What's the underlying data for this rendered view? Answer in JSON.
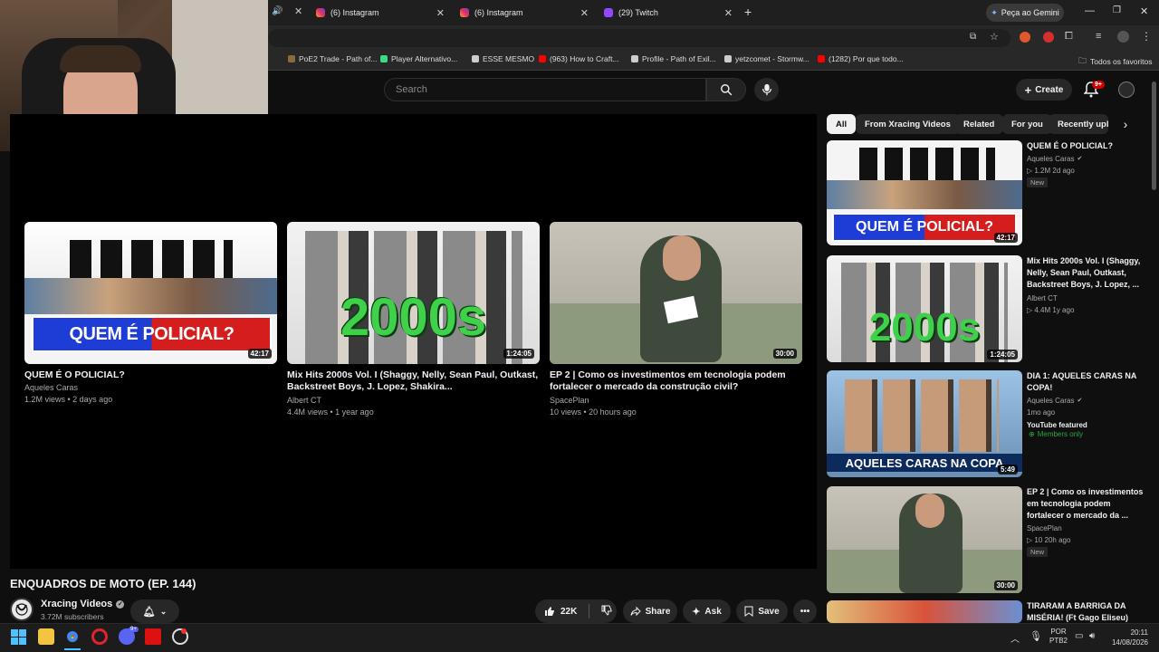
{
  "browser": {
    "tabs": [
      {
        "label": "(6) Instagram"
      },
      {
        "label": "(6) Instagram"
      },
      {
        "label": "(29) Twitch"
      }
    ],
    "gemini_label": "Peça ao Gemini",
    "bookmarks": [
      {
        "label": "PoE2 Trade - Path of..."
      },
      {
        "label": "Player Alternativo..."
      },
      {
        "label": "ESSE MESMO"
      },
      {
        "label": "(963) How to Craft..."
      },
      {
        "label": "Profile - Path of Exil..."
      },
      {
        "label": "yetzcomet - Stormw..."
      },
      {
        "label": "(1282) Por que todo..."
      }
    ],
    "bookmarks_folder": "Todos os favoritos"
  },
  "youtube": {
    "search_placeholder": "Search",
    "create_label": "Create",
    "notif_count": "9+"
  },
  "endscreen": [
    {
      "title": "QUEM É O POLICIAL?",
      "channel": "Aqueles Caras",
      "meta": "1.2M views • 2 days ago",
      "duration": "42:17",
      "thumb_text": "QUEM É POLICIAL?"
    },
    {
      "title": "Mix Hits 2000s Vol. I (Shaggy, Nelly, Sean Paul, Outkast, Backstreet Boys, J. Lopez, Shakira...",
      "channel": "Albert CT",
      "meta": "4.4M views • 1 year ago",
      "duration": "1:24:05",
      "thumb_text": "2000s"
    },
    {
      "title": "EP 2 | Como os investimentos em tecnologia podem fortalecer o mercado da construção civil?",
      "channel": "SpacePlan",
      "meta": "10 views • 20 hours ago",
      "duration": "30:00",
      "thumb_text": ""
    }
  ],
  "video": {
    "title": "ENQUADROS DE MOTO (EP. 144)",
    "channel": "Xracing Videos",
    "subscribers": "3.72M subscribers",
    "likes": "22K",
    "share": "Share",
    "ask": "Ask",
    "save": "Save"
  },
  "chips": [
    "All",
    "From Xracing Videos",
    "Related",
    "For you",
    "Recently uplo"
  ],
  "related": [
    {
      "title": "QUEM É O POLICIAL?",
      "channel": "Aqueles Caras",
      "stats": "1.2M  2d ago",
      "badge": "New",
      "duration": "42:17",
      "thumb_text": "QUEM É POLICIAL?"
    },
    {
      "title": "Mix Hits 2000s Vol. I (Shaggy, Nelly, Sean Paul, Outkast, Backstreet Boys, J. Lopez, ...",
      "channel": "Albert CT",
      "stats": "4.4M  1y ago",
      "badge": "",
      "duration": "1:24:05",
      "thumb_text": "2000s"
    },
    {
      "title": "DIA 1: AQUELES CARAS NA COPA!",
      "channel": "Aqueles Caras",
      "stats": "1mo ago",
      "badge": "YouTube featured",
      "badge2": "Members only",
      "duration": "5:49",
      "thumb_text": "AQUELES CARAS NA COPA"
    },
    {
      "title": "EP 2 | Como os investimentos em tecnologia podem fortalecer o mercado da ...",
      "channel": "SpacePlan",
      "stats": "10  20h ago",
      "badge": "New",
      "duration": "30:00",
      "thumb_text": ""
    },
    {
      "title": "TIRARAM A BARRIGA DA MISÉRIA! (Ft Gago Eliseu)",
      "channel": "",
      "stats": "",
      "badge": "",
      "duration": "",
      "thumb_text": ""
    }
  ],
  "taskbar": {
    "lang1": "POR",
    "lang2": "PTB2",
    "time": "20:11",
    "date": "14/08/2026",
    "notif_badge": "9+"
  }
}
